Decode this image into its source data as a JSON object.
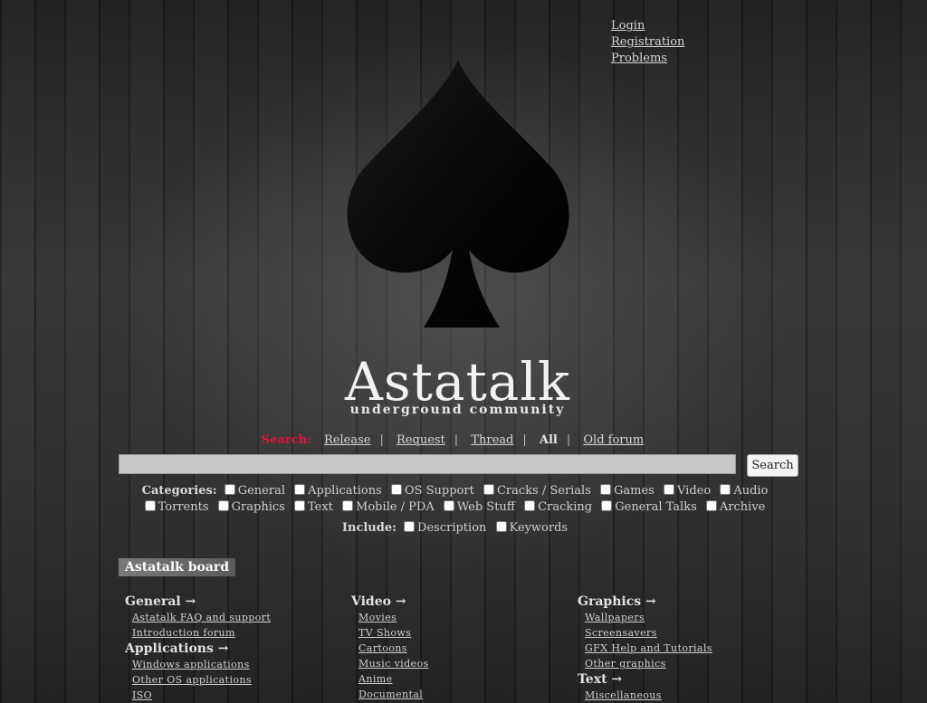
{
  "top_links": [
    "Login",
    "Registration",
    "Problems"
  ],
  "brand": {
    "title": "Astatalk",
    "subtitle": "underground community"
  },
  "search": {
    "label": "Search:",
    "modes": [
      "Release",
      "Request",
      "Thread",
      "All",
      "Old forum"
    ],
    "active_mode": "All",
    "input_value": "",
    "button_label": "Search"
  },
  "categories": {
    "label": "Categories:",
    "row1": [
      "General",
      "Applications",
      "OS Support",
      "Cracks / Serials",
      "Games",
      "Video",
      "Audio"
    ],
    "row2": [
      "Torrents",
      "Graphics",
      "Text",
      "Mobile / PDA",
      "Web Stuff",
      "Cracking",
      "General Talks",
      "Archive"
    ]
  },
  "include": {
    "label": "Include:",
    "options": [
      "Description",
      "Keywords"
    ]
  },
  "board": {
    "title": "Astatalk board",
    "columns": [
      [
        {
          "title": "General →",
          "links": [
            "Astatalk FAQ and support",
            "Introduction forum"
          ]
        },
        {
          "title": "Applications →",
          "links": [
            "Windows applications",
            "Other OS applications",
            "ISO"
          ]
        }
      ],
      [
        {
          "title": "Video →",
          "links": [
            "Movies",
            "TV Shows",
            "Cartoons",
            "Music videos",
            "Anime",
            "Documental"
          ]
        }
      ],
      [
        {
          "title": "Graphics →",
          "links": [
            "Wallpapers",
            "Screensavers",
            "GFX Help and Tutorials",
            "Other graphics"
          ]
        },
        {
          "title": "Text →",
          "links": [
            "Miscellaneous"
          ]
        }
      ]
    ]
  },
  "colors": {
    "search_label": "#e0143c",
    "text": "#cfcfcf",
    "title": "#f2f2f2"
  },
  "icons": {
    "logo": "spade-icon"
  }
}
